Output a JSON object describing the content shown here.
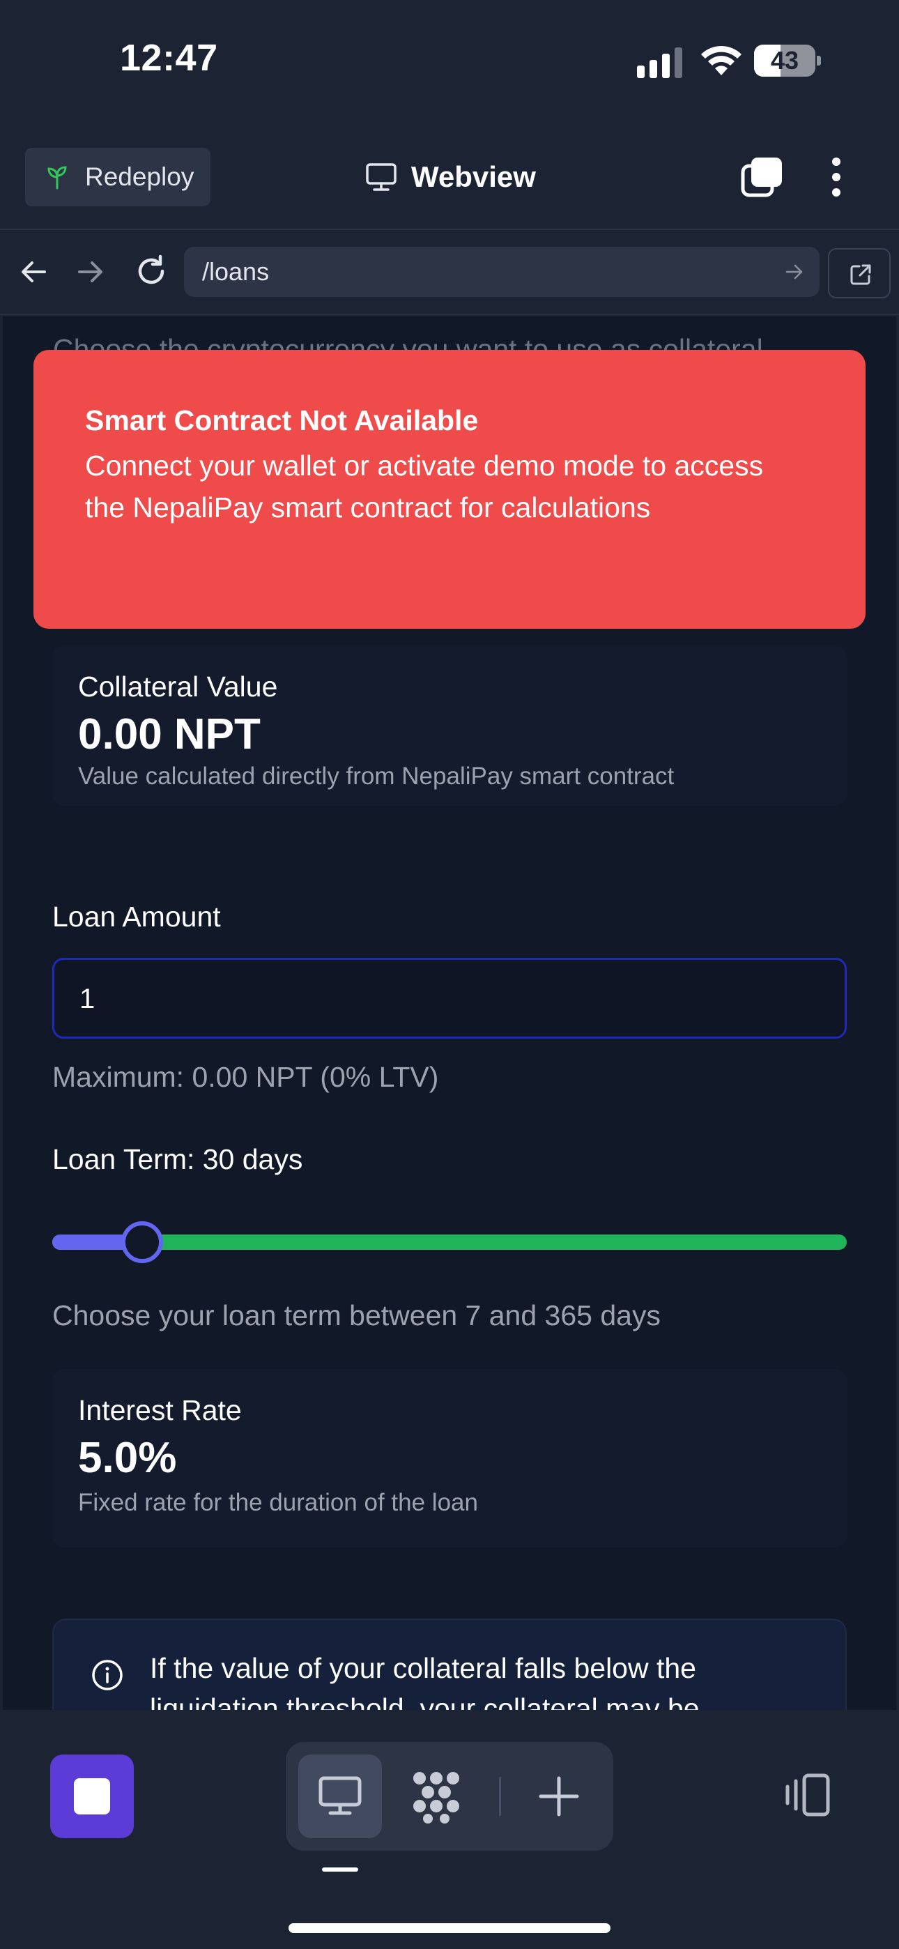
{
  "status_bar": {
    "time": "12:47",
    "battery_level": "43",
    "battery_fraction": 0.43
  },
  "app_bar": {
    "redeploy_label": "Redeploy",
    "title": "Webview"
  },
  "url_bar": {
    "path": "/loans"
  },
  "page": {
    "cut_text": "Choose the cryptocurrency you want to use as collateral",
    "error_toast": {
      "title": "Smart Contract Not Available",
      "message": "Connect your wallet or activate demo mode to access the NepaliPay smart contract for calculations"
    },
    "collateral": {
      "label": "Collateral Value",
      "value": "0.00 NPT",
      "note": "Value calculated directly from NepaliPay smart contract"
    },
    "loan_amount": {
      "label": "Loan Amount",
      "value": "1",
      "maximum": "Maximum: 0.00 NPT (0% LTV)"
    },
    "loan_term": {
      "label": "Loan Term: 30 days",
      "value_days": 30,
      "min_days": 7,
      "max_days": 365,
      "help": "Choose your loan term between 7 and 365 days"
    },
    "interest": {
      "label": "Interest Rate",
      "value": "5.0%",
      "note": "Fixed rate for the duration of the loan"
    },
    "info_text": "If the value of your collateral falls below the liquidation threshold, your collateral may be"
  },
  "colors": {
    "background": "#1c2333",
    "webview_bg": "#111827",
    "error": "#ef4b4b",
    "slider_active": "#6366f1",
    "slider_track": "#1fb45a",
    "accent": "#5b3cd6"
  },
  "icons": [
    "sprout-icon",
    "monitor-icon",
    "tabs-icon",
    "more-vertical-icon",
    "arrow-left-icon",
    "arrow-right-icon",
    "reload-icon",
    "external-link-icon",
    "info-icon",
    "stop-icon",
    "apps-icon",
    "plus-icon",
    "rotate-device-icon"
  ]
}
